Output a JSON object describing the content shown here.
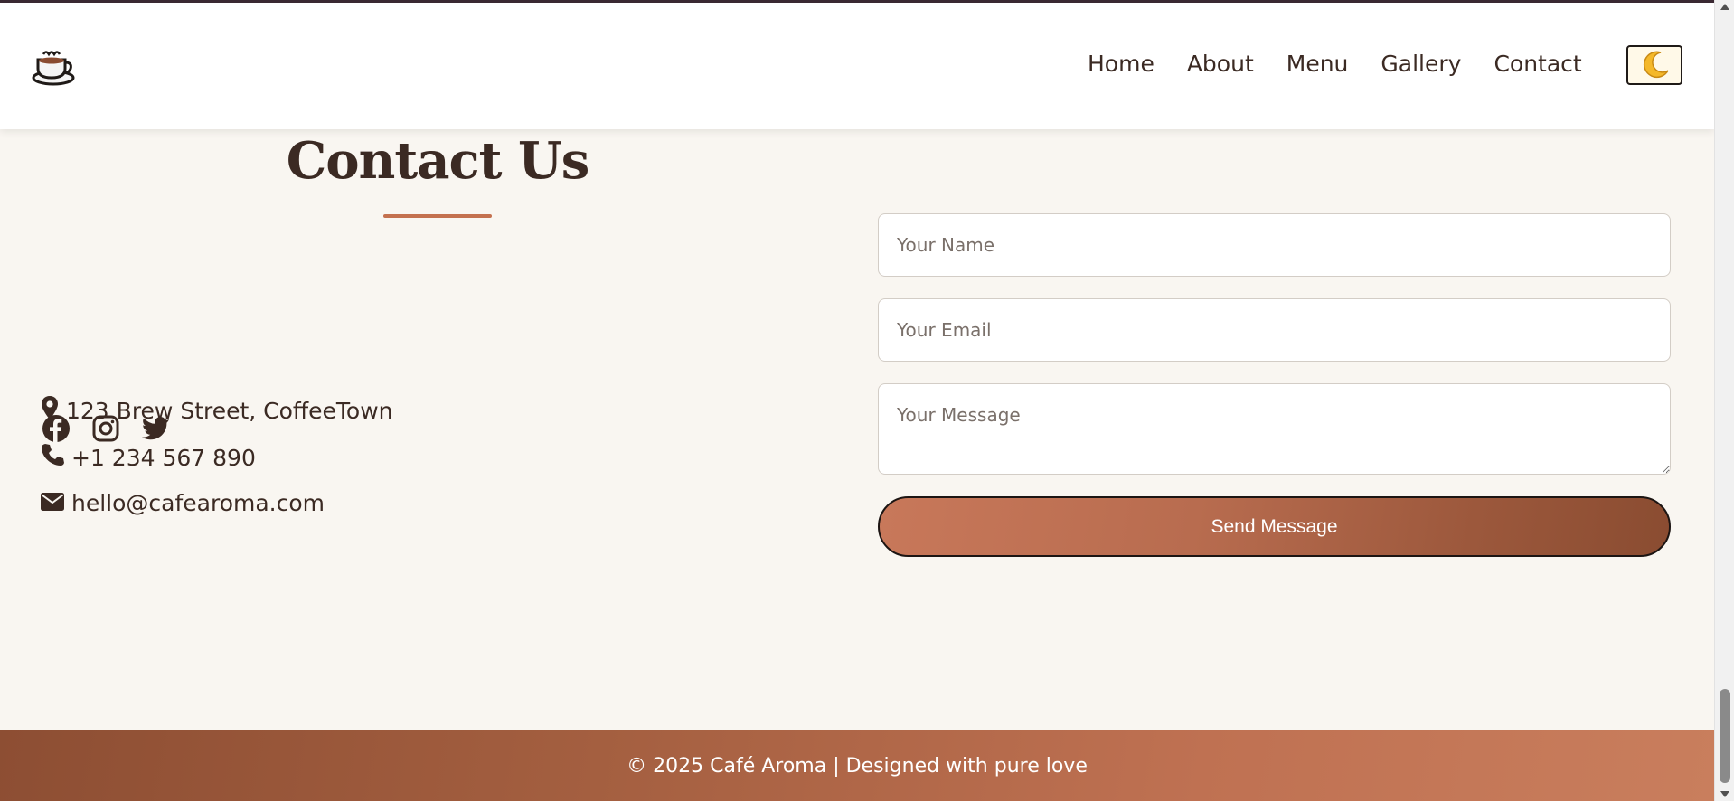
{
  "nav": {
    "logo_icon": "coffee-cup-icon",
    "links": [
      {
        "label": "Home"
      },
      {
        "label": "About"
      },
      {
        "label": "Menu"
      },
      {
        "label": "Gallery"
      },
      {
        "label": "Contact"
      }
    ],
    "theme_toggle_icon": "crescent-moon-icon"
  },
  "contact": {
    "title": "Contact Us",
    "address": "123 Brew Street, CoffeeTown",
    "phone": "+1 234 567 890",
    "email": "hello@cafearoma.com",
    "socials": [
      {
        "icon": "facebook-icon"
      },
      {
        "icon": "instagram-icon"
      },
      {
        "icon": "twitter-icon"
      }
    ]
  },
  "form": {
    "name_placeholder": "Your Name",
    "email_placeholder": "Your Email",
    "message_placeholder": "Your Message",
    "submit_label": "Send Message"
  },
  "footer": {
    "text": "© 2025 Café Aroma | Designed with pure love"
  },
  "colors": {
    "accent": "#c4714f",
    "text": "#3b2a23",
    "background": "#f9f6f1"
  }
}
